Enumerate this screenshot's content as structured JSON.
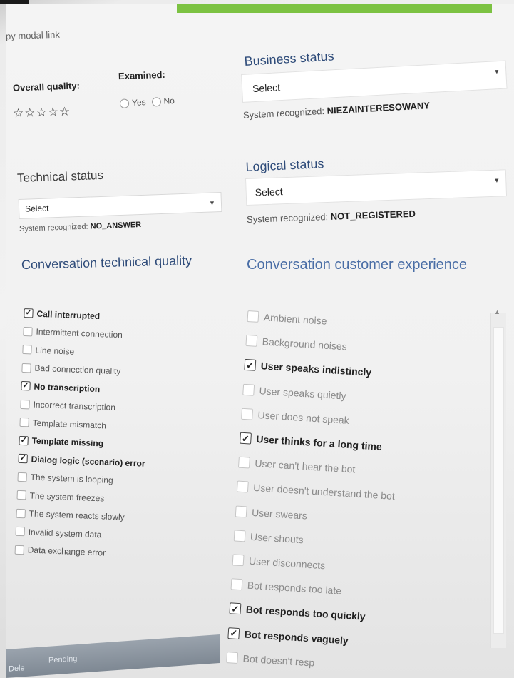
{
  "modal_link": "py modal link",
  "overall_quality": {
    "label": "Overall quality:",
    "stars": [
      "☆",
      "☆",
      "☆",
      "☆",
      "☆"
    ]
  },
  "examined": {
    "label": "Examined:",
    "options": [
      "Yes",
      "No"
    ]
  },
  "technical_status": {
    "title": "Technical status",
    "select_value": "Select",
    "system_recognized_label": "System recognized:",
    "system_recognized_value": "NO_ANSWER"
  },
  "business_status": {
    "title": "Business status",
    "select_value": "Select",
    "system_recognized_label": "System recognized:",
    "system_recognized_value": "NIEZAINTERESOWANY"
  },
  "logical_status": {
    "title": "Logical status",
    "select_value": "Select",
    "system_recognized_label": "System recognized:",
    "system_recognized_value": "NOT_REGISTERED"
  },
  "technical_quality": {
    "title": "Conversation technical quality",
    "items": [
      {
        "label": "Call interrupted",
        "checked": true
      },
      {
        "label": "Intermittent connection",
        "checked": false
      },
      {
        "label": "Line noise",
        "checked": false
      },
      {
        "label": "Bad connection quality",
        "checked": false
      },
      {
        "label": "No transcription",
        "checked": true
      },
      {
        "label": "Incorrect transcription",
        "checked": false
      },
      {
        "label": "Template mismatch",
        "checked": false
      },
      {
        "label": "Template missing",
        "checked": true
      },
      {
        "label": "Dialog logic (scenario) error",
        "checked": true
      },
      {
        "label": "The system is looping",
        "checked": false
      },
      {
        "label": "The system freezes",
        "checked": false
      },
      {
        "label": "The system reacts slowly",
        "checked": false
      },
      {
        "label": "Invalid system data",
        "checked": false
      },
      {
        "label": "Data exchange error",
        "checked": false
      }
    ]
  },
  "customer_experience": {
    "title": "Conversation customer experience",
    "items": [
      {
        "label": "Ambient noise",
        "checked": false
      },
      {
        "label": "Background noises",
        "checked": false
      },
      {
        "label": "User speaks indistincly",
        "checked": true
      },
      {
        "label": "User speaks quietly",
        "checked": false
      },
      {
        "label": "User does not speak",
        "checked": false
      },
      {
        "label": "User thinks for a long time",
        "checked": true
      },
      {
        "label": "User can't hear the bot",
        "checked": false
      },
      {
        "label": "User doesn't understand the bot",
        "checked": false
      },
      {
        "label": "User swears",
        "checked": false
      },
      {
        "label": "User shouts",
        "checked": false
      },
      {
        "label": "User disconnects",
        "checked": false
      },
      {
        "label": "Bot responds too late",
        "checked": false
      },
      {
        "label": "Bot responds too quickly",
        "checked": true
      },
      {
        "label": "Bot responds vaguely",
        "checked": true
      },
      {
        "label": "Bot doesn't resp",
        "checked": false
      }
    ]
  },
  "footer": {
    "pending": "Pending",
    "delete": "Dele"
  },
  "icons": {
    "checkmark": "✓",
    "caret": "▼",
    "scroll_up": "▲"
  },
  "colors": {
    "accent_green": "#7cc242",
    "title_blue": "#2f4c7a",
    "title_light_blue": "#4a6ea6"
  }
}
